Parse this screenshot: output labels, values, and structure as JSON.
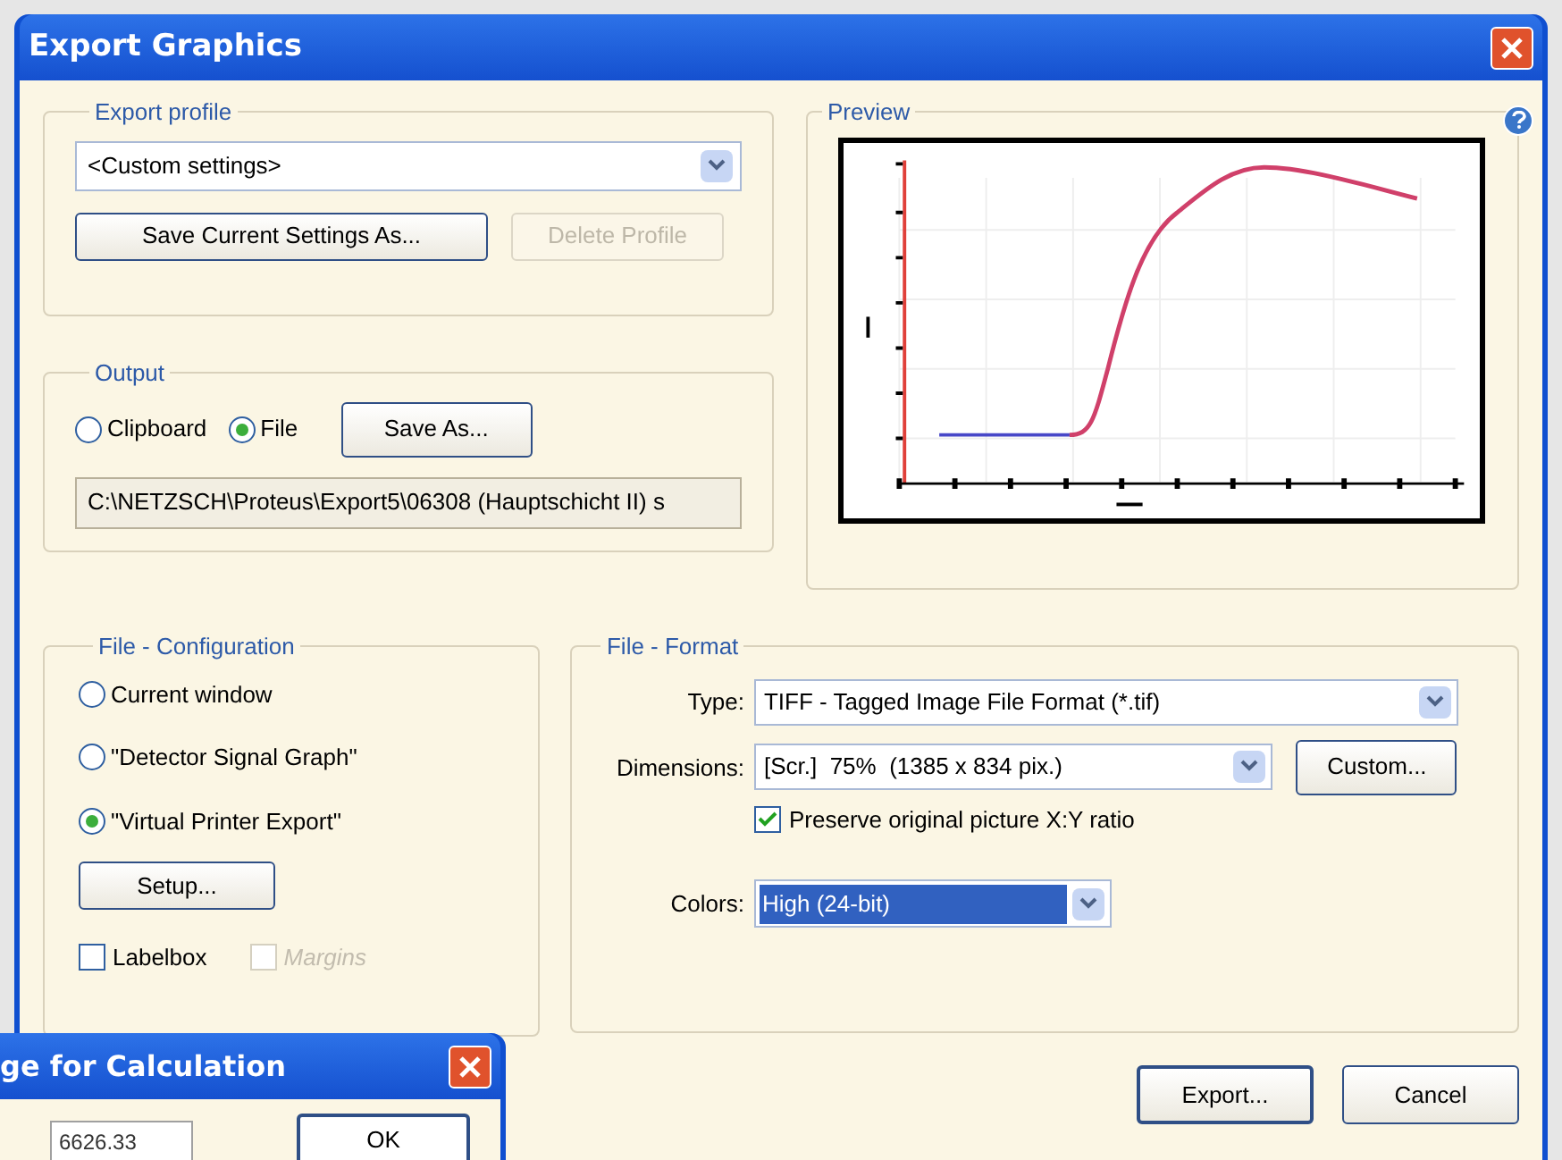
{
  "window": {
    "title": "Export Graphics"
  },
  "export_profile": {
    "title": "Export profile",
    "profile": "<Custom settings>",
    "buttons": [
      {
        "label": "Save Current Settings As...",
        "disabled": false
      },
      {
        "label": "Delete Profile",
        "disabled": true
      }
    ]
  },
  "output": {
    "title": "Output",
    "targets": [
      {
        "label": "Clipboard",
        "selected": false
      },
      {
        "label": "File",
        "selected": true
      }
    ],
    "save_as": "Save As...",
    "path": "C:\\NETZSCH\\Proteus\\Export5\\06308 (Hauptschicht II) s"
  },
  "preview": {
    "title": "Preview"
  },
  "file_configuration": {
    "title": "File - Configuration",
    "sources": [
      {
        "label": "Current window",
        "selected": false
      },
      {
        "label": "\"Detector Signal Graph\"",
        "selected": false
      },
      {
        "label": "\"Virtual Printer Export\"",
        "selected": true
      }
    ],
    "setup": "Setup...",
    "options": [
      {
        "label": "Labelbox",
        "checked": false,
        "disabled": false
      },
      {
        "label": "Margins",
        "checked": false,
        "disabled": true
      }
    ]
  },
  "file_format": {
    "title": "File - Format",
    "type": {
      "label": "Type:",
      "value": "TIFF - Tagged Image File Format (*.tif)"
    },
    "dimensions": {
      "label": "Dimensions:",
      "value": "[Scr.]  75%  (1385 x 834 pix.)"
    },
    "custom": "Custom...",
    "preserve_ratio": {
      "label": "Preserve original picture X:Y ratio",
      "checked": true
    },
    "colors": {
      "label": "Colors:",
      "value": "High (24-bit)"
    }
  },
  "buttons": [
    "Export...",
    "Cancel"
  ],
  "calculation_dialog": {
    "title": "ge for Calculation",
    "value": "6626.33",
    "ok": "OK"
  }
}
